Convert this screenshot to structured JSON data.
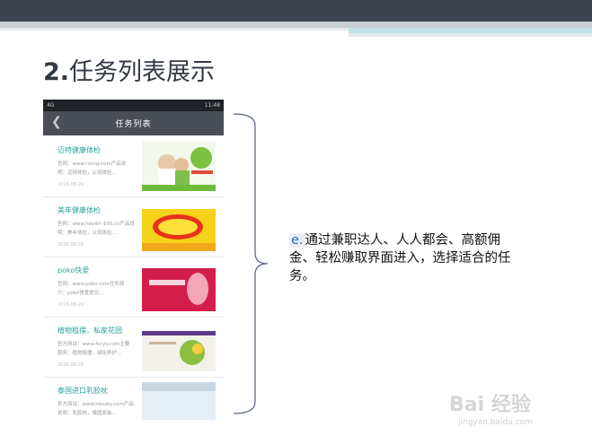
{
  "slide": {
    "title_num": "2.",
    "title_text": "任务列表展示"
  },
  "phone": {
    "status_left": "4G",
    "status_right": "11:48",
    "nav_title": "任务列表",
    "back_icon": "chevron-left-icon"
  },
  "tasks": [
    {
      "name": "迈特健康体检",
      "desc1": "官网：www.rising.com产品说",
      "desc2": "明：迈特体检，父母体检...",
      "date": "2016-08-26"
    },
    {
      "name": "美年健康体检",
      "desc1": "官网：www.health-100.cn产品说",
      "desc2": "明：美年体检，父母体检...",
      "date": "2016-08-26"
    },
    {
      "name": "poko快爱",
      "desc1": "官网：www.poko.com任务简",
      "desc2": "介：poko快爱提交...",
      "date": "2016-08-26"
    },
    {
      "name": "植物租摆，私家花园",
      "desc1": "官方网站：www.fscyy.com主要",
      "desc2": "服务：植物租摆，绿化养护...",
      "date": "2016-08-26"
    },
    {
      "name": "泰国进口乳胶枕",
      "desc1": "官方网站：www.tdsuby.com产品",
      "desc2": "说明：乳胶枕，泰国原装...",
      "date": ""
    }
  ],
  "callout": {
    "marker": "e.",
    "text": "通过兼职达人、人人都会、高额佣金、轻松赚取界面进入，选择适合的任务。"
  },
  "watermark": {
    "brand": "Bai 经验",
    "url": "jingyan.baidu.com"
  }
}
